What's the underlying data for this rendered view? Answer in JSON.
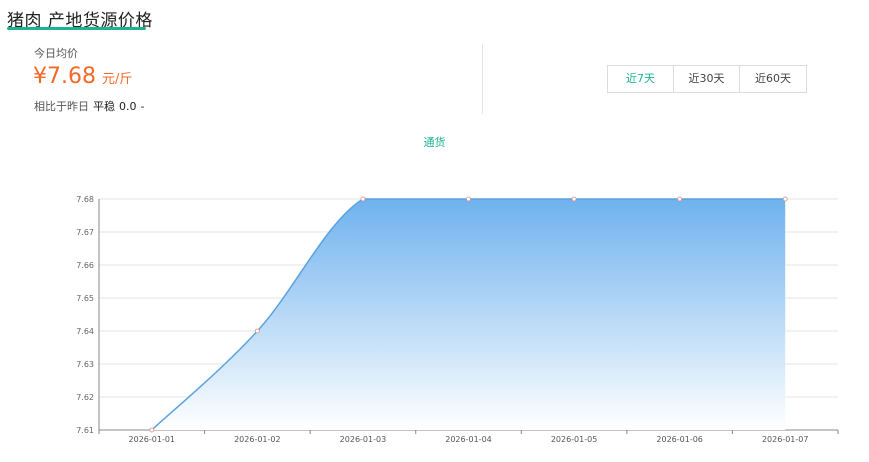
{
  "header": {
    "title": "猪肉 产地货源价格"
  },
  "summary": {
    "today_label": "今日均价",
    "price": "¥7.68",
    "unit": "元/斤",
    "compare_label": "相比于昨日",
    "trend": "平稳",
    "change": "0.0",
    "change_suffix": "-"
  },
  "range_tabs": [
    {
      "label": "近7天",
      "active": true
    },
    {
      "label": "近30天",
      "active": false
    },
    {
      "label": "近60天",
      "active": false
    }
  ],
  "colors": {
    "accent": "#1bb394",
    "price": "#f06a2a",
    "line": "#5aa2de",
    "fill_top": "#6fb2ee",
    "fill_bottom": "#ffffff"
  },
  "chart_data": {
    "type": "area",
    "x": [
      "2026-01-01",
      "2026-01-02",
      "2026-01-03",
      "2026-01-04",
      "2026-01-05",
      "2026-01-06",
      "2026-01-07"
    ],
    "series": [
      {
        "name": "通货",
        "values": [
          7.61,
          7.64,
          7.68,
          7.68,
          7.68,
          7.68,
          7.68
        ]
      }
    ],
    "y_ticks": [
      "7.61",
      "7.62",
      "7.63",
      "7.64",
      "7.65",
      "7.66",
      "7.67",
      "7.68"
    ],
    "ylim": [
      7.61,
      7.68
    ],
    "grid": true,
    "legend_position": "top-center"
  }
}
